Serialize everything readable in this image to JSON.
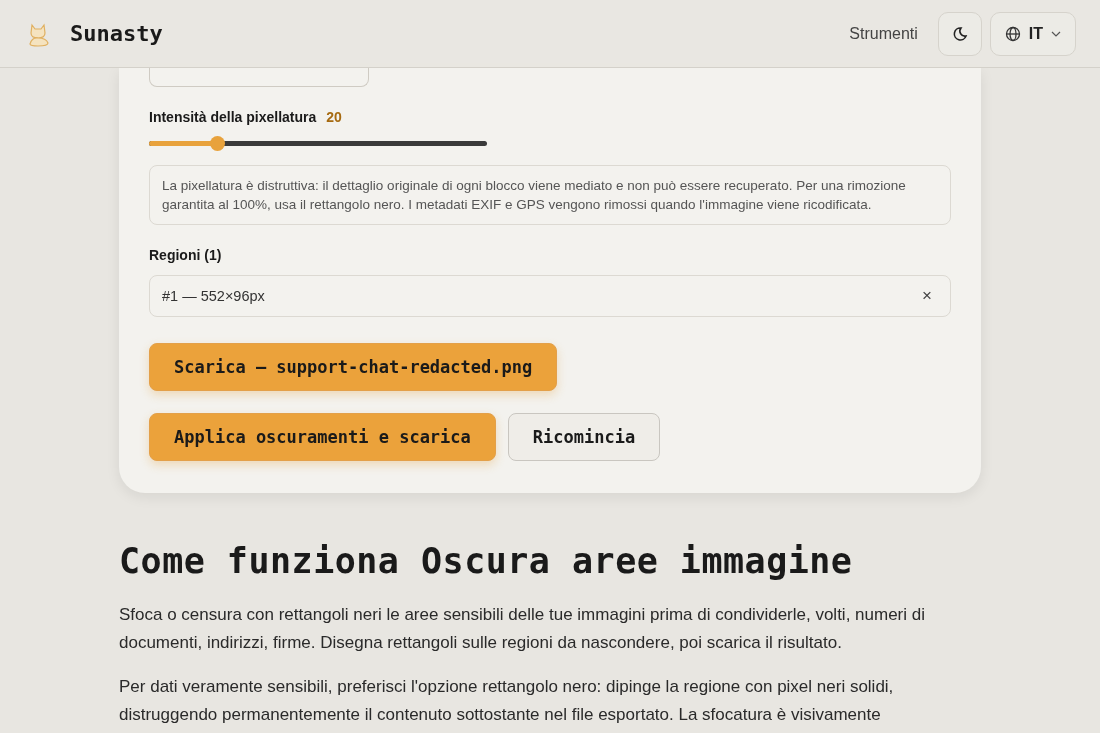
{
  "header": {
    "brand": "Sunasty",
    "nav_link": "Strumenti",
    "language": "IT"
  },
  "editor": {
    "intensity": {
      "label": "Intensità della pixellatura",
      "reading": "20",
      "level": 0.2
    },
    "notice": "La pixellatura è distruttiva: il dettaglio originale di ogni blocco viene mediato e non può essere recuperato. Per una rimozione garantita al 100%, usa il rettangolo nero. I metadati EXIF e GPS vengono rimossi quando l'immagine viene ricodificata.",
    "regions_label": "Regioni (1)",
    "regions": [
      {
        "label": "#1 — 552×96px",
        "remove": "×"
      }
    ],
    "download_button": "Scarica — support-chat-redacted.png",
    "buttons": [
      {
        "label": "Applica oscuramenti e scarica",
        "kind": "primary"
      },
      {
        "label": "Ricomincia",
        "kind": "secondary"
      }
    ]
  },
  "article": {
    "title": "Come funziona Oscura aree immagine",
    "paragraphs": [
      "Sfoca o censura con rettangoli neri le aree sensibili delle tue immagini prima di condividerle, volti, numeri di documenti, indirizzi, firme. Disegna rettangoli sulle regioni da nascondere, poi scarica il risultato.",
      "Per dati veramente sensibili, preferisci l'opzione rettangolo nero: dipinge la regione con pixel neri solidi, distruggendo permanentemente il contenuto sottostante nel file esportato. La sfocatura è visivamente"
    ]
  }
}
